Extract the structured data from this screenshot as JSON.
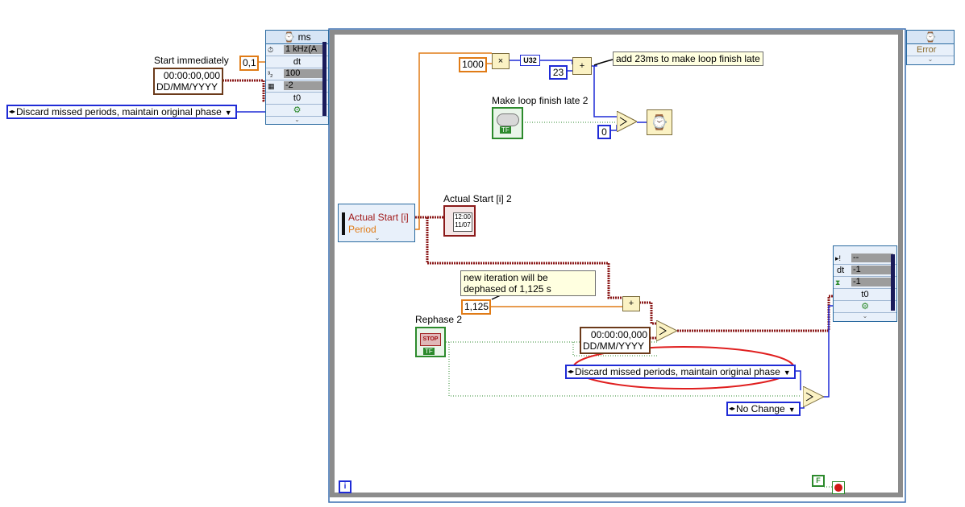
{
  "outer_timed_node": {
    "header": "ms",
    "rows": [
      "1 kHz(A",
      "dt",
      "100",
      "-2",
      "t0"
    ]
  },
  "start_label": "Start immediately",
  "start_time": {
    "value": "00:00:00,000",
    "format": "DD/MM/YYYY"
  },
  "dt_constant": "0,1",
  "mode_enum": "Discard missed periods, maintain original phase",
  "right_error_node": {
    "label": "Error"
  },
  "const_1000": "1000",
  "const_u32": "U32",
  "const_23": "23",
  "note_add23": "add 23ms to make loop finish late",
  "make_late_label": "Make loop finish late 2",
  "bool_tf": "TF",
  "const_0": "0",
  "left_data_node": {
    "rows": [
      "Actual Start [i]",
      "Period"
    ]
  },
  "actual_start_label": "Actual Start [i] 2",
  "ts_indicator": {
    "time": "12:00",
    "date": "11/07"
  },
  "note_dephase": "new iteration will be dephased of 1,125 s",
  "const_1125": "1,125",
  "rephase_label": "Rephase 2",
  "stop_text": "STOP",
  "inner_ts": {
    "value": "00:00:00,000",
    "format": "DD/MM/YYYY"
  },
  "inner_mode_enum": "Discard missed periods, maintain original phase",
  "no_change_enum": "No Change",
  "right_timing_node": {
    "rows": [
      "--",
      "-1",
      "-1",
      "t0"
    ],
    "labels": [
      "dt"
    ]
  },
  "loop_iter": "i",
  "bool_f": "F",
  "colors": {
    "orange": "#e07b16",
    "blue": "#1f2bd6",
    "brown": "#6b3a1a",
    "green": "#2c8a2c",
    "red": "#d01818",
    "frame": "#8c8c8c"
  }
}
